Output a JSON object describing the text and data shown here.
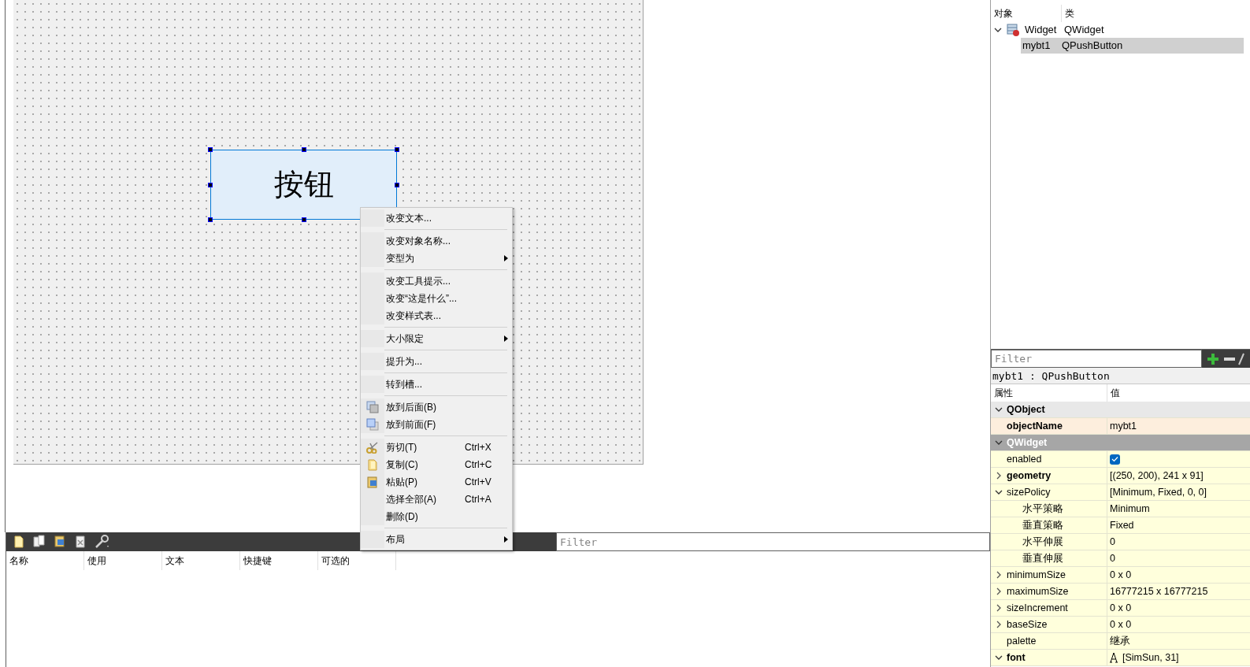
{
  "form": {
    "button_text": "按钮",
    "selected": true
  },
  "context_menu": {
    "sections": [
      [
        {
          "label": "改变文本...",
          "has_submenu": false
        }
      ],
      [
        {
          "label": "改变对象名称...",
          "has_submenu": false
        },
        {
          "label": "变型为",
          "has_submenu": true
        }
      ],
      [
        {
          "label": "改变工具提示...",
          "has_submenu": false
        },
        {
          "label": "改变“这是什么”...",
          "has_submenu": false
        },
        {
          "label": "改变样式表...",
          "has_submenu": false
        }
      ],
      [
        {
          "label": "大小限定",
          "has_submenu": true
        }
      ],
      [
        {
          "label": "提升为...",
          "has_submenu": false
        }
      ],
      [
        {
          "label": "转到槽...",
          "has_submenu": false
        }
      ],
      [
        {
          "label": "放到后面(B)",
          "has_submenu": false
        },
        {
          "label": "放到前面(F)",
          "has_submenu": false
        }
      ],
      [
        {
          "label": "剪切(T)",
          "shortcut": "Ctrl+X",
          "has_submenu": false
        },
        {
          "label": "复制(C)",
          "shortcut": "Ctrl+C",
          "has_submenu": false
        },
        {
          "label": "粘贴(P)",
          "shortcut": "Ctrl+V",
          "has_submenu": false
        },
        {
          "label": "选择全部(A)",
          "shortcut": "Ctrl+A",
          "has_submenu": false
        },
        {
          "label": "删除(D)",
          "has_submenu": false
        }
      ],
      [
        {
          "label": "布局",
          "has_submenu": true
        }
      ]
    ]
  },
  "action_editor": {
    "filter": {
      "placeholder": "Filter"
    },
    "columns": [
      "名称",
      "使用",
      "文本",
      "快捷键",
      "可选的"
    ]
  },
  "object_inspector": {
    "columns": [
      "对象",
      "类"
    ],
    "tree": [
      {
        "name": "Widget",
        "class": "QWidget",
        "expanded": true,
        "selected": false,
        "children": [
          {
            "name": "mybt1",
            "class": "QPushButton",
            "selected": true
          }
        ]
      }
    ]
  },
  "property_editor": {
    "filter": {
      "placeholder": "Filter"
    },
    "title": "mybt1 : QPushButton",
    "columns": [
      "属性",
      "值"
    ],
    "rows": [
      {
        "kind": "group",
        "name": "QObject",
        "expanded": true,
        "color": "#e8e8e8"
      },
      {
        "kind": "property",
        "name": "objectName",
        "value": "mybt1",
        "bold": true,
        "color": "#fdeedd"
      },
      {
        "kind": "group",
        "name": "QWidget",
        "expanded": true,
        "color": "#a6a6a6"
      },
      {
        "kind": "checkbox",
        "name": "enabled",
        "checked": true,
        "bold": false,
        "color": "#ffffdc"
      },
      {
        "kind": "property",
        "name": "geometry",
        "value": "[(250, 200), 241 x 91]",
        "bold": true,
        "expanded": false,
        "color": "#ffffdc"
      },
      {
        "kind": "property",
        "name": "sizePolicy",
        "value": "[Minimum, Fixed, 0, 0]",
        "bold": false,
        "expanded": true,
        "color": "#ffffdc",
        "children": [
          {
            "kind": "property",
            "name": "水平策略",
            "value": "Minimum",
            "bold": false,
            "color": "#ffffdc"
          },
          {
            "kind": "property",
            "name": "垂直策略",
            "value": "Fixed",
            "bold": false,
            "color": "#ffffdc"
          },
          {
            "kind": "property",
            "name": "水平伸展",
            "value": "0",
            "bold": false,
            "color": "#ffffdc"
          },
          {
            "kind": "property",
            "name": "垂直伸展",
            "value": "0",
            "bold": false,
            "color": "#ffffdc"
          }
        ]
      },
      {
        "kind": "property",
        "name": "minimumSize",
        "value": "0 x 0",
        "bold": false,
        "expanded": false,
        "color": "#ffffdc"
      },
      {
        "kind": "property",
        "name": "maximumSize",
        "value": "16777215 x 16777215",
        "bold": false,
        "expanded": false,
        "color": "#ffffdc"
      },
      {
        "kind": "property",
        "name": "sizeIncrement",
        "value": "0 x 0",
        "bold": false,
        "expanded": false,
        "color": "#ffffdc"
      },
      {
        "kind": "property",
        "name": "baseSize",
        "value": "0 x 0",
        "bold": false,
        "expanded": false,
        "color": "#ffffdc"
      },
      {
        "kind": "property",
        "name": "palette",
        "value": "继承",
        "bold": false,
        "color": "#ffffdc"
      },
      {
        "kind": "font",
        "name": "font",
        "value": "[SimSun, 31]",
        "bold": true,
        "expanded": true,
        "color": "#ffffdc"
      }
    ]
  }
}
